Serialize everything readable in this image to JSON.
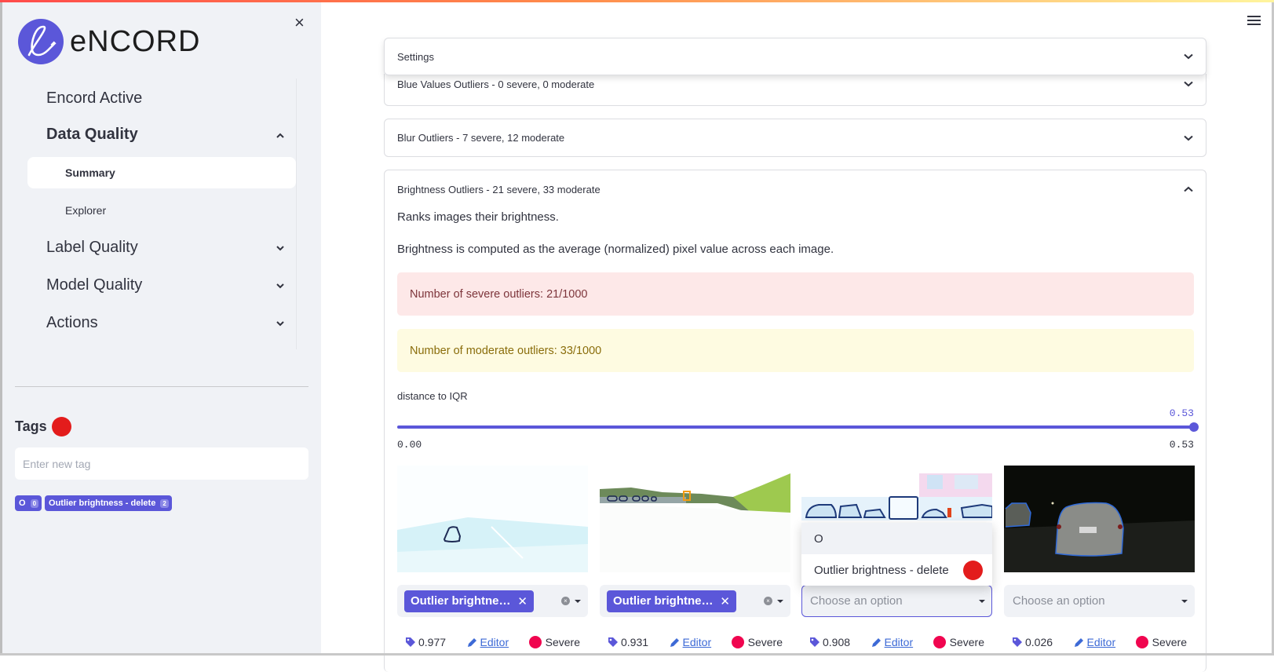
{
  "app": {
    "brand": "eNCORD",
    "accent_color": "#5b57d9"
  },
  "sidebar": {
    "close_label": "×",
    "nav": [
      {
        "label": "Encord Active",
        "expanded": null
      },
      {
        "label": "Data Quality",
        "expanded": true
      },
      {
        "label": "Label Quality",
        "expanded": false
      },
      {
        "label": "Model Quality",
        "expanded": false
      },
      {
        "label": "Actions",
        "expanded": false
      }
    ],
    "sub_items": [
      {
        "label": "Summary",
        "active": true
      },
      {
        "label": "Explorer",
        "active": false
      }
    ],
    "tags": {
      "title": "Tags",
      "input_placeholder": "Enter new tag",
      "chips": [
        {
          "label": "O",
          "count": "0"
        },
        {
          "label": "Outlier brightness - delete",
          "count": "2"
        }
      ]
    }
  },
  "main": {
    "accordions": [
      {
        "title": "Settings",
        "expanded": false
      },
      {
        "title": "Blue Values Outliers - 0 severe, 0 moderate",
        "expanded": false
      },
      {
        "title": "Blur Outliers - 7 severe, 12 moderate",
        "expanded": false
      },
      {
        "title": "Brightness Outliers - 21 severe, 33 moderate",
        "expanded": true
      }
    ],
    "brightness": {
      "description": [
        "Ranks images their brightness.",
        "Brightness is computed as the average (normalized) pixel value across each image."
      ],
      "severe_alert": "Number of severe outliers: 21/1000",
      "moderate_alert": "Number of moderate outliers: 33/1000",
      "slider": {
        "label": "distance to IQR",
        "value": "0.53",
        "min": "0.00",
        "max": "0.53",
        "fraction": 1.0
      },
      "cards": [
        {
          "scene": "overexposed-highway",
          "selected_tag": "Outlier brightne…",
          "placeholder": "",
          "score": "0.977",
          "editor_label": "Editor",
          "severity": "Severe"
        },
        {
          "scene": "overexposed-hillside-road",
          "selected_tag": "Outlier brightne…",
          "placeholder": "",
          "score": "0.931",
          "editor_label": "Editor",
          "severity": "Severe"
        },
        {
          "scene": "overexposed-parked-cars",
          "selected_tag": "",
          "placeholder": "Choose an option",
          "score": "0.908",
          "editor_label": "Editor",
          "severity": "Severe",
          "dropdown_open": true,
          "dropdown_options": [
            "O",
            "Outlier brightness - delete"
          ]
        },
        {
          "scene": "dark-night-car",
          "selected_tag": "",
          "placeholder": "Choose an option",
          "score": "0.026",
          "editor_label": "Editor",
          "severity": "Severe"
        }
      ]
    }
  }
}
